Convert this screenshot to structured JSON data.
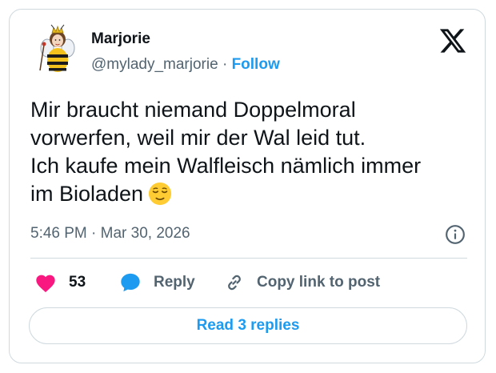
{
  "author": {
    "name": "Marjorie",
    "handle": "@mylady_marjorie",
    "separator": "·",
    "follow_label": "Follow"
  },
  "tweet": {
    "lines": [
      "Mir braucht niemand Doppelmoral",
      "vorwerfen, weil mir der Wal leid tut.",
      "Ich kaufe mein Walfleisch nämlich immer",
      "im Bioladen"
    ],
    "emoji": "relieved-face-emoji",
    "timestamp": "5:46 PM · Mar 30, 2026"
  },
  "actions": {
    "like_count": "53",
    "reply_label": "Reply",
    "copy_label": "Copy link to post"
  },
  "read_replies_label": "Read 3 replies",
  "icons": {
    "brand": "x-logo-icon",
    "info": "info-icon",
    "like": "heart-icon",
    "reply": "speech-bubble-icon",
    "copy": "link-icon"
  },
  "colors": {
    "accent": "#1d9bf0",
    "like": "#f91880",
    "text": "#0f1419",
    "muted": "#536471",
    "border": "#cfd9de"
  }
}
